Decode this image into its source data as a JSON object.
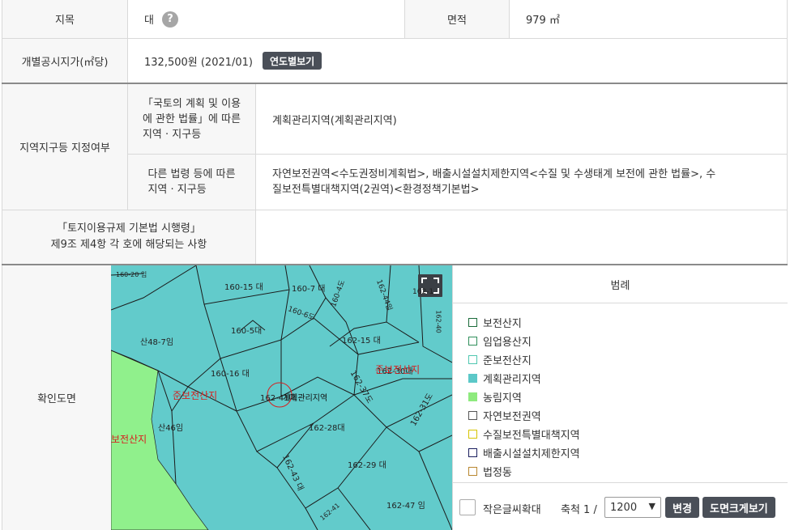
{
  "rows": {
    "jimok_label": "지목",
    "jimok_value": "대",
    "help_glyph": "?",
    "area_label": "면적",
    "area_value": "979 ㎡",
    "price_label": "개별공시지가(㎡당)",
    "price_value": "132,500원 (2021/01)",
    "price_button": "연도별보기",
    "zone_label": "지역지구등 지정여부",
    "zone_sub1_line1": "「국토의 계획 및 이용",
    "zone_sub1_line2": "에 관한 법률」에 따른",
    "zone_sub1_line3": "지역 · 지구등",
    "zone_sub1_value": "계획관리지역(계획관리지역)",
    "zone_sub2_line1": "다른 법령 등에 따른",
    "zone_sub2_line2": "지역 · 지구등",
    "zone_sub2_value_line1": "자연보전권역<수도권정비계획법>, 배출시설설치제한지역<수질 및 수생태계 보전에 관한 법률>, 수",
    "zone_sub2_value_line2": "질보전특별대책지역(2권역)<환경정책기본법>",
    "decree_line1": "「토지이용규제 기본법 시행령」",
    "decree_line2": "제9조 제4항 각 호에 해당되는 사항",
    "decree_value": "",
    "map_label": "확인도면"
  },
  "map": {
    "parcels": [
      "160-20 임",
      "160-15 대",
      "160-7 대",
      "160-4도",
      "160-6도",
      "162-44임",
      "162-1",
      "162-40",
      "160-5대",
      "162-15 대",
      "산48-7임",
      "160-16 대",
      "162-30대",
      "162-37도",
      "162-31도",
      "162-28대",
      "산46임",
      "162-43 대",
      "162-29 대",
      "162-47 임",
      "162-41"
    ],
    "zones": [
      "준보전산지",
      "계획관리지역",
      "준보전산지",
      "보전산지"
    ],
    "subject_parcel": "162-41대"
  },
  "legend": {
    "title": "범례",
    "items": [
      {
        "label": "보전산지",
        "color": "#1a6b3a",
        "fill": "#ffffff"
      },
      {
        "label": "임업용산지",
        "color": "#2f8f5b",
        "fill": "#ffffff"
      },
      {
        "label": "준보전산지",
        "color": "#4fc7b0",
        "fill": "#ffffff"
      },
      {
        "label": "계획관리지역",
        "color": "#5cc8c8",
        "fill": "#5cc8c8"
      },
      {
        "label": "농림지역",
        "color": "#8eea7e",
        "fill": "#8eea7e"
      },
      {
        "label": "자연보전권역",
        "color": "#555555",
        "fill": "#ffffff"
      },
      {
        "label": "수질보전특별대책지역",
        "color": "#d6c400",
        "fill": "#ffffff"
      },
      {
        "label": "배출시설설치제한지역",
        "color": "#1a1f5e",
        "fill": "#ffffff"
      },
      {
        "label": "법정동",
        "color": "#b8862f",
        "fill": "#ffffff"
      }
    ]
  },
  "controls": {
    "enlarge_text_label": "작은글씨확대",
    "scale_label": "축척 1 /",
    "scale_value": "1200",
    "change_button": "변경",
    "bigmap_button": "도면크게보기"
  }
}
